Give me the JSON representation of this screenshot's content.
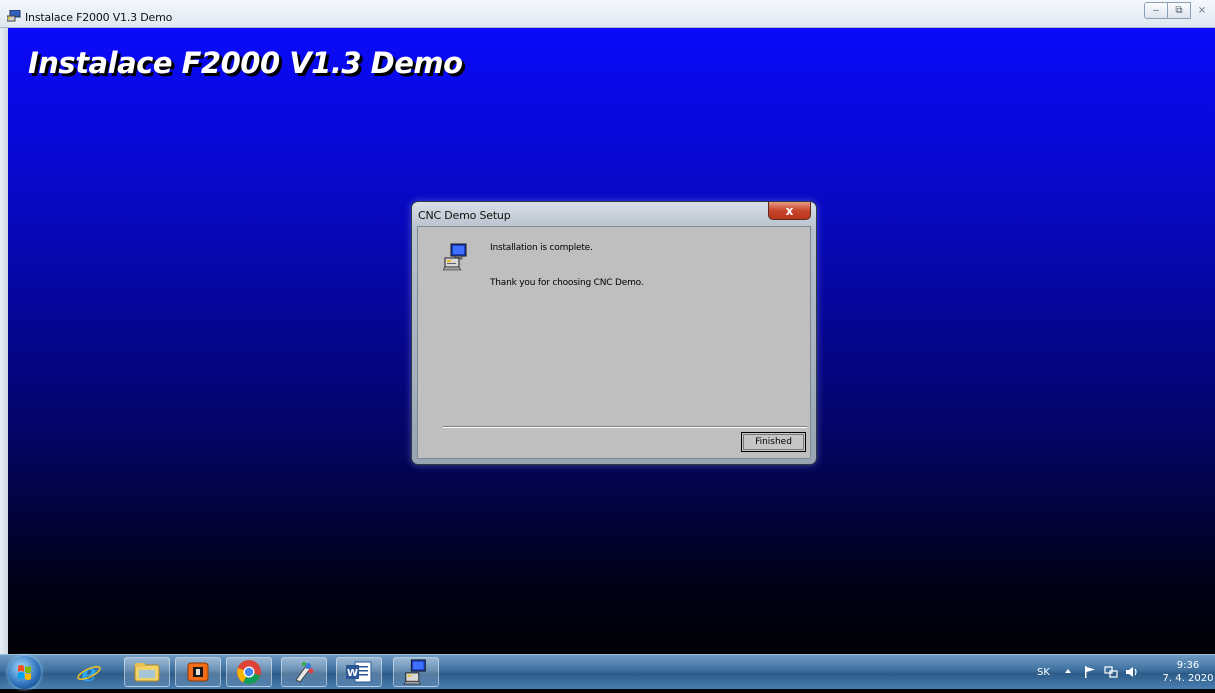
{
  "window": {
    "title": "Instalace F2000 V1.3 Demo",
    "controls": {
      "minimize_icon": "minimize-icon",
      "maximize_icon": "maximize-icon",
      "close_icon": "close-icon"
    }
  },
  "installer": {
    "heading": "Instalace F2000 V1.3 Demo",
    "background_top": "#0a0afa",
    "background_bottom": "#000005"
  },
  "dialog": {
    "title": "CNC Demo Setup",
    "close_glyph": "x",
    "icon": "setup-computer-icon",
    "message_line1": "Installation is complete.",
    "message_line2": "Thank you for choosing CNC Demo.",
    "finished_label": "Finished"
  },
  "taskbar": {
    "start_icon": "windows-start-icon",
    "apps": [
      {
        "name": "internet-explorer",
        "icon": "internet-explorer-icon"
      },
      {
        "name": "file-explorer",
        "icon": "folder-icon"
      },
      {
        "name": "media-player",
        "icon": "media-player-icon"
      },
      {
        "name": "chrome",
        "icon": "chrome-icon"
      },
      {
        "name": "paint",
        "icon": "paint-icon"
      },
      {
        "name": "word",
        "icon": "word-icon"
      },
      {
        "name": "setup",
        "icon": "setup-computer-icon"
      }
    ],
    "tray": {
      "language": "SK",
      "time": "9:36",
      "date": "7. 4. 2020",
      "icons": [
        "show-hidden-icons-icon",
        "action-center-flag-icon",
        "network-icon",
        "volume-icon"
      ]
    }
  }
}
